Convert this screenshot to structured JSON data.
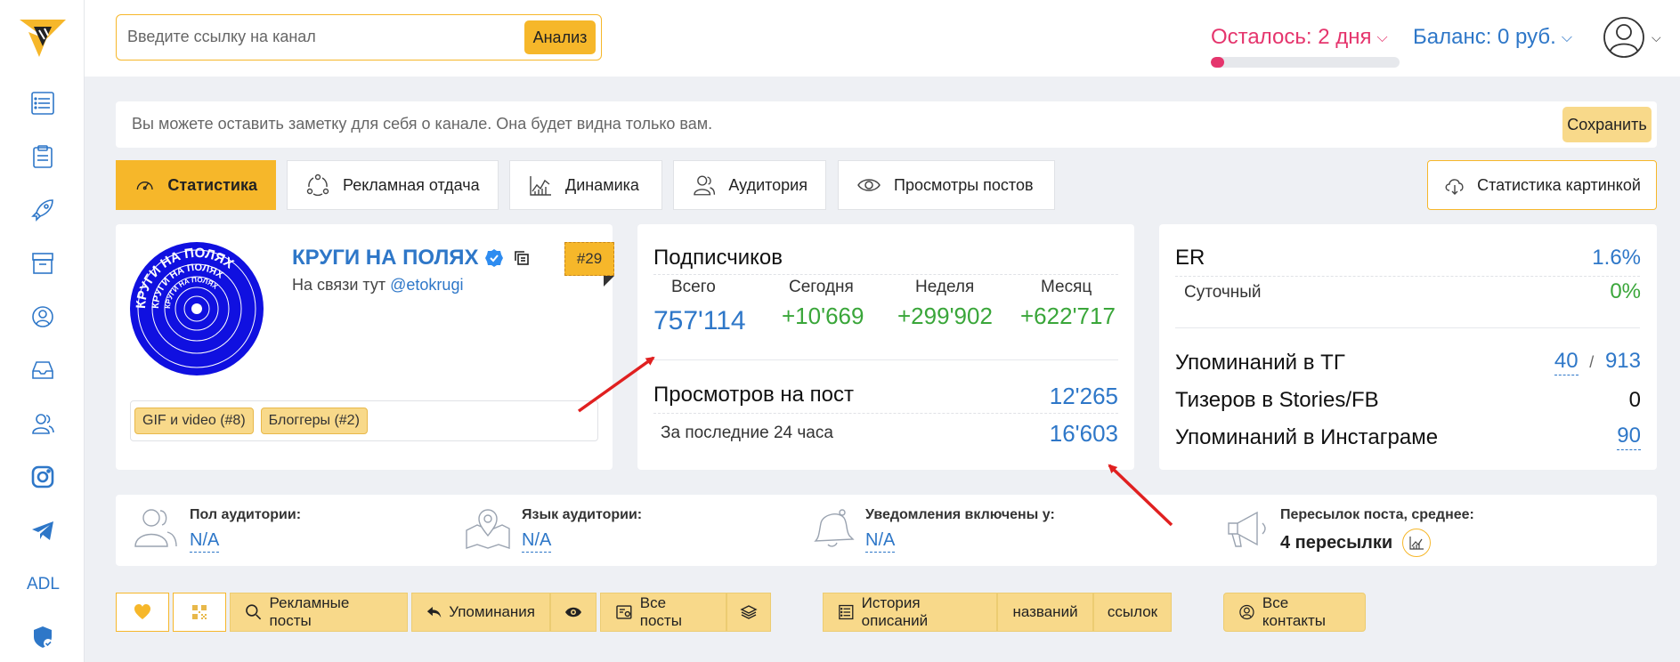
{
  "search": {
    "placeholder": "Введите ссылку на канал",
    "button": "Анализ"
  },
  "header": {
    "remaining": "Осталось: 2 дня",
    "remaining_progress": 0.07,
    "balance": "Баланс: 0 руб."
  },
  "sidebar": {
    "items": [
      {
        "icon": "list-icon"
      },
      {
        "icon": "clipboard-icon"
      },
      {
        "icon": "rocket-icon"
      },
      {
        "icon": "archive-icon"
      },
      {
        "icon": "globe-user-icon"
      },
      {
        "icon": "inbox-icon"
      },
      {
        "icon": "users-icon"
      },
      {
        "icon": "instagram-icon"
      },
      {
        "icon": "telegram-icon"
      },
      {
        "label": "ADL"
      },
      {
        "icon": "shield-check-icon"
      }
    ]
  },
  "note": {
    "text": "Вы можете оставить заметку для себя о канале. Она будет видна только вам.",
    "save": "Сохранить"
  },
  "tabs": [
    {
      "label": "Статистика",
      "icon": "speedometer-icon",
      "active": true
    },
    {
      "label": "Рекламная отдача",
      "icon": "network-icon"
    },
    {
      "label": "Динамика",
      "icon": "chart-icon"
    },
    {
      "label": "Аудитория",
      "icon": "users-icon"
    },
    {
      "label": "Просмотры постов",
      "icon": "eye-icon"
    }
  ],
  "image_stats": {
    "label": "Статистика картинкой",
    "icon": "cloud-download-icon"
  },
  "channel": {
    "name": "КРУГИ НА ПОЛЯХ",
    "contact_prefix": "На связи тут",
    "contact_handle": "@etokrugi",
    "rank": "#29",
    "tags": [
      "GIF и video (#8)",
      "Блоггеры (#2)"
    ],
    "logo_text": "КРУГИ НА ПОЛЯХ"
  },
  "subscribers": {
    "title": "Подписчиков",
    "columns": [
      {
        "label": "Всего",
        "value": "757'114"
      },
      {
        "label": "Сегодня",
        "value": "+10'669"
      },
      {
        "label": "Неделя",
        "value": "+299'902"
      },
      {
        "label": "Месяц",
        "value": "+622'717"
      }
    ],
    "views_label": "Просмотров на пост",
    "views_value": "12'265",
    "views24_label": "За последние 24 часа",
    "views24_value": "16'603"
  },
  "engagement": {
    "er_label": "ER",
    "er_value": "1.6%",
    "daily_label": "Суточный",
    "daily_value": "0%",
    "mentions_tg_label": "Упоминаний в ТГ",
    "mentions_tg_value1": "40",
    "mentions_tg_sep": "/",
    "mentions_tg_value2": "913",
    "teasers_label": "Тизеров в Stories/FB",
    "teasers_value": "0",
    "mentions_ig_label": "Упоминаний в Инстаграме",
    "mentions_ig_value": "90"
  },
  "audience": [
    {
      "label": "Пол аудитории:",
      "value": "N/A",
      "icon": "users-icon"
    },
    {
      "label": "Язык аудитории:",
      "value": "N/A",
      "icon": "map-pin-icon"
    },
    {
      "label": "Уведомления включены у:",
      "value": "N/A",
      "icon": "bell-icon"
    },
    {
      "label": "Пересылок поста, среднее:",
      "value": "4 пересылки",
      "icon": "megaphone-icon"
    }
  ],
  "bottom": {
    "ads": "Рекламные посты",
    "mentions": "Упоминания",
    "all_posts": "Все посты",
    "history": "История описаний",
    "names": "названий",
    "links": "ссылок",
    "contacts": "Все контакты"
  },
  "colors": {
    "accent": "#f6b72a",
    "blue": "#2e77c8",
    "green": "#3aa63a",
    "pink": "#e5356d"
  }
}
